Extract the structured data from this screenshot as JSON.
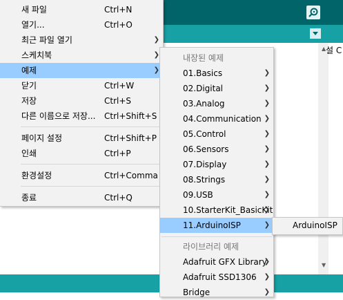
{
  "ide": {
    "editor_text": "설 C",
    "icons": {
      "serial_monitor": "serial-monitor-icon",
      "tab_menu": "dropdown-triangle-icon"
    }
  },
  "file_menu": {
    "items": [
      {
        "label": "새 파일",
        "shortcut": "Ctrl+N"
      },
      {
        "label": "열기...",
        "shortcut": "Ctrl+O"
      },
      {
        "label": "최근 파일 열기",
        "shortcut": ""
      },
      {
        "label": "스케치북",
        "shortcut": ""
      },
      {
        "label": "예제",
        "shortcut": ""
      },
      {
        "label": "닫기",
        "shortcut": "Ctrl+W"
      },
      {
        "label": "저장",
        "shortcut": "Ctrl+S"
      },
      {
        "label": "다른 이름으로 저장...",
        "shortcut": "Ctrl+Shift+S"
      },
      {
        "label": "페이지 설정",
        "shortcut": "Ctrl+Shift+P"
      },
      {
        "label": "인쇄",
        "shortcut": "Ctrl+P"
      },
      {
        "label": "환경설정",
        "shortcut": "Ctrl+Comma"
      },
      {
        "label": "종료",
        "shortcut": "Ctrl+Q"
      }
    ],
    "highlighted": "예제"
  },
  "examples_menu": {
    "header_builtin": "내장된 예제",
    "builtin": [
      "01.Basics",
      "02.Digital",
      "03.Analog",
      "04.Communication",
      "05.Control",
      "06.Sensors",
      "07.Display",
      "08.Strings",
      "09.USB",
      "10.StarterKit_BasicKit",
      "11.ArduinoISP"
    ],
    "header_library": "라이브러리 예제",
    "library": [
      "Adafruit GFX Library",
      "Adafruit SSD1306",
      "Bridge"
    ],
    "highlighted": "11.ArduinoISP"
  },
  "isp_menu": {
    "items": [
      "ArduinoISP"
    ]
  },
  "colors": {
    "highlight": "#99ccff",
    "teal_dark": "#006468",
    "teal_light": "#17a1a5",
    "menu_bg": "#f2f2f2"
  }
}
